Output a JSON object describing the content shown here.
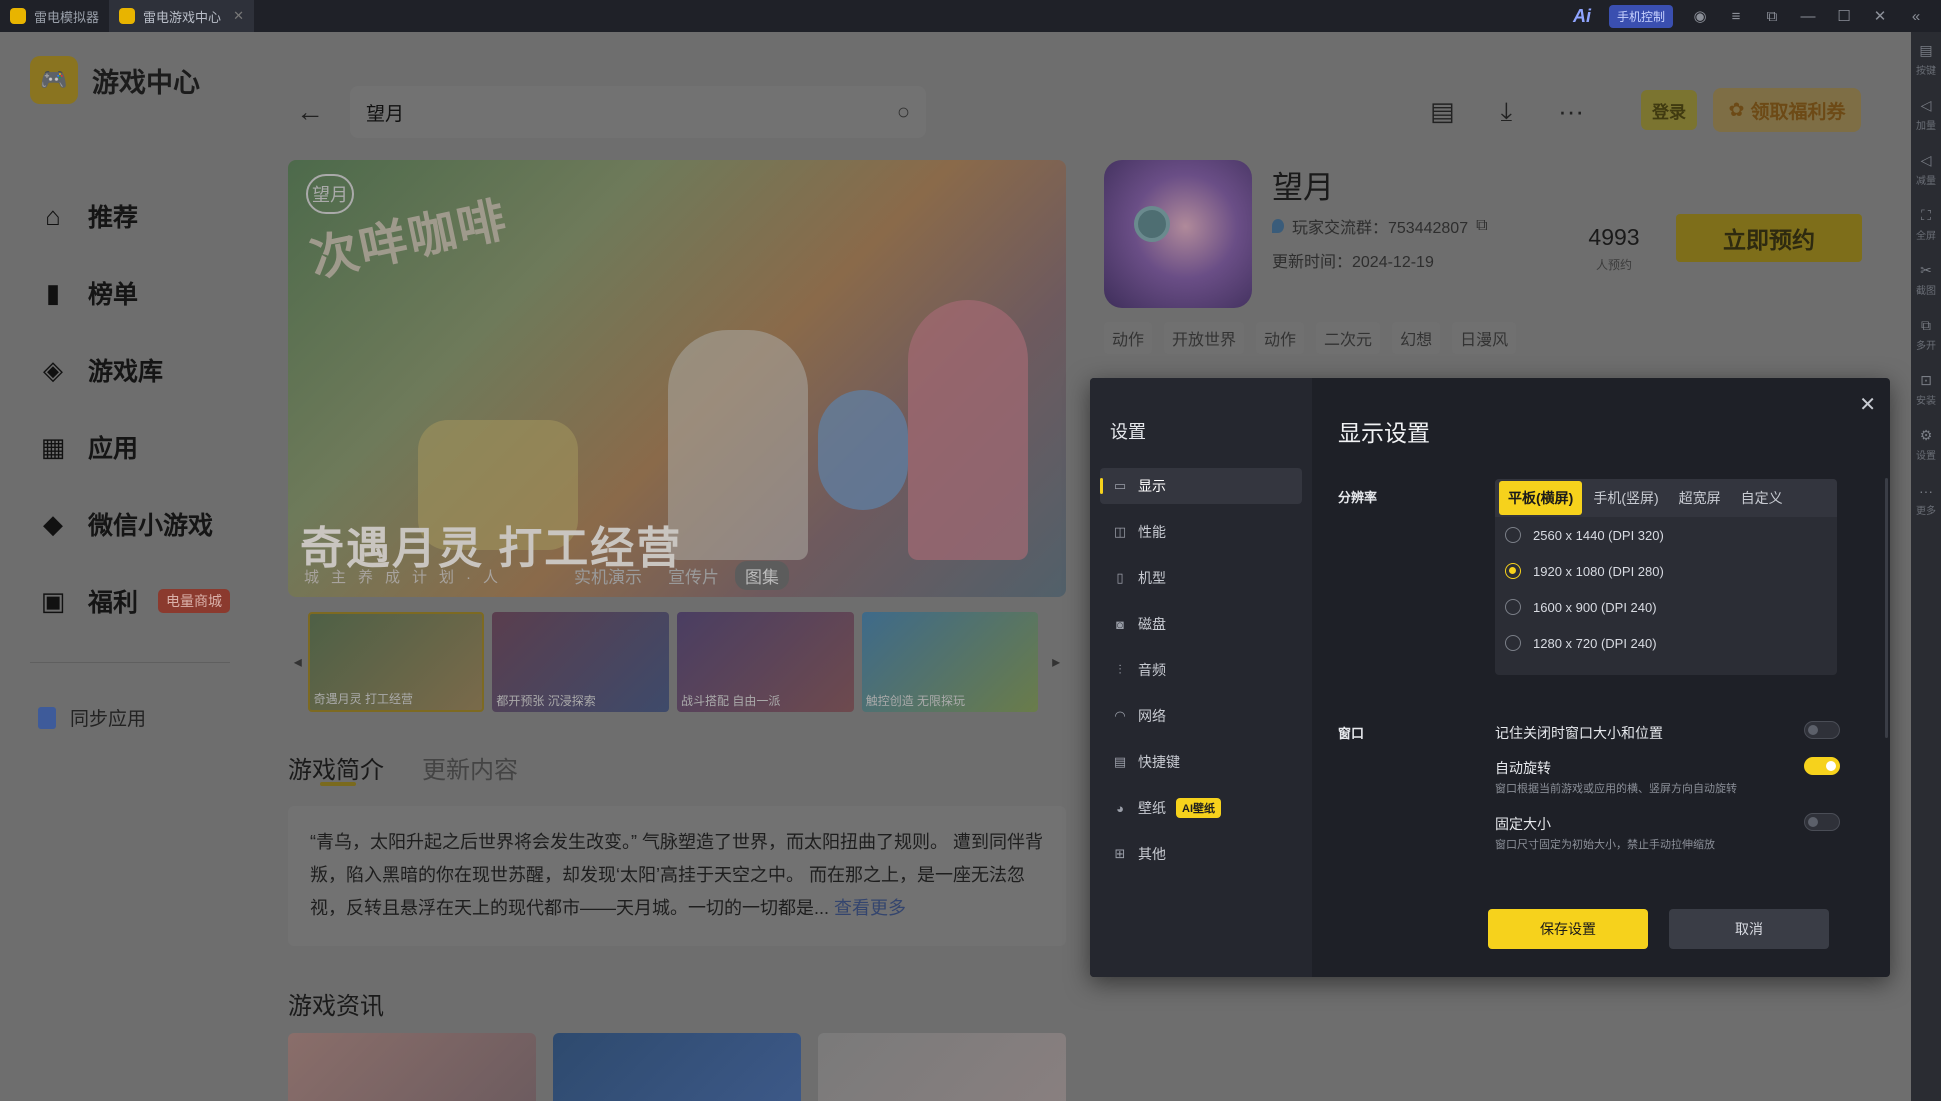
{
  "titlebar": {
    "tabs": [
      {
        "label": "雷电模拟器",
        "active": false
      },
      {
        "label": "雷电游戏中心",
        "active": true
      }
    ],
    "ai_label": "Ai",
    "phone_control": "手机控制"
  },
  "sidebar": {
    "app_title": "游戏中心",
    "items": [
      {
        "label": "推荐",
        "icon": "home-icon"
      },
      {
        "label": "榜单",
        "icon": "chart-icon"
      },
      {
        "label": "游戏库",
        "icon": "gamepad-icon"
      },
      {
        "label": "应用",
        "icon": "apps-icon"
      },
      {
        "label": "微信小游戏",
        "icon": "diamond-icon"
      },
      {
        "label": "福利",
        "icon": "gift-icon",
        "badge": "电量商城"
      }
    ],
    "sync_label": "同步应用"
  },
  "header": {
    "search_value": "望月",
    "login_label": "登录",
    "welfare_label": "领取福利券"
  },
  "hero": {
    "logo_text": "望月",
    "signage": "次咩咖啡",
    "caption": "奇遇月灵 打工经营",
    "subcaption": "城主养成计划·人",
    "tabs": [
      {
        "label": "实机演示",
        "active": false
      },
      {
        "label": "宣传片",
        "active": false
      },
      {
        "label": "图集",
        "active": true
      }
    ]
  },
  "thumbnails": [
    {
      "label": "奇遇月灵 打工经营"
    },
    {
      "label": "都开预张 沉浸探索"
    },
    {
      "label": "战斗搭配 自由一派"
    },
    {
      "label": "触控创造 无限探玩"
    }
  ],
  "intro": {
    "tabs": [
      {
        "label": "游戏简介",
        "active": true
      },
      {
        "label": "更新内容",
        "active": false
      }
    ],
    "text": "“青乌，太阳升起之后世界将会发生改变。” 气脉塑造了世界，而太阳扭曲了规则。 遭到同伴背叛，陷入黑暗的你在现世苏醒，却发现‘太阳’高挂于天空之中。 而在那之上，是一座无法忽视，反转且悬浮在天上的现代都市——天月城。一切的一切都是...",
    "more": "查看更多",
    "news_title": "游戏资讯"
  },
  "game": {
    "name": "望月",
    "group": "玩家交流群：753442807",
    "update": "更新时间：2024-12-19",
    "reserve_count": "4993",
    "reserve_label": "人预约",
    "reserve_button": "立即预约",
    "tags": [
      "动作",
      "开放世界",
      "动作",
      "二次元",
      "幻想",
      "日漫风"
    ]
  },
  "rail": [
    {
      "label": "按键"
    },
    {
      "label": "加量"
    },
    {
      "label": "减量"
    },
    {
      "label": "全屏"
    },
    {
      "label": "截图"
    },
    {
      "label": "多开"
    },
    {
      "label": "安装"
    },
    {
      "label": "设置"
    },
    {
      "label": "更多"
    }
  ],
  "settings": {
    "sidebar_title": "设置",
    "nav": [
      {
        "label": "显示",
        "icon": "monitor-icon",
        "active": true
      },
      {
        "label": "性能",
        "icon": "performance-icon"
      },
      {
        "label": "机型",
        "icon": "phone-icon"
      },
      {
        "label": "磁盘",
        "icon": "disk-icon"
      },
      {
        "label": "音频",
        "icon": "audio-icon"
      },
      {
        "label": "网络",
        "icon": "wifi-icon"
      },
      {
        "label": "快捷键",
        "icon": "keyboard-icon"
      },
      {
        "label": "壁纸",
        "icon": "palette-icon",
        "badge": "AI壁纸"
      },
      {
        "label": "其他",
        "icon": "grid-icon"
      }
    ],
    "title": "显示设置",
    "resolution_label": "分辨率",
    "resolution_tabs": [
      {
        "label": "平板(横屏)",
        "active": true
      },
      {
        "label": "手机(竖屏)"
      },
      {
        "label": "超宽屏"
      },
      {
        "label": "自定义"
      }
    ],
    "resolutions": [
      {
        "label": "2560 x 1440  (DPI 320)",
        "selected": false
      },
      {
        "label": "1920 x 1080  (DPI 280)",
        "selected": true
      },
      {
        "label": "1600 x 900  (DPI 240)",
        "selected": false
      },
      {
        "label": "1280 x 720  (DPI 240)",
        "selected": false
      }
    ],
    "window_label": "窗口",
    "window_options": [
      {
        "title": "记住关闭时窗口大小和位置",
        "desc": "",
        "on": false
      },
      {
        "title": "自动旋转",
        "desc": "窗口根据当前游戏或应用的横、竖屏方向自动旋转",
        "on": true
      },
      {
        "title": "固定大小",
        "desc": "窗口尺寸固定为初始大小，禁止手动拉伸缩放",
        "on": false
      }
    ],
    "save_label": "保存设置",
    "cancel_label": "取消"
  }
}
